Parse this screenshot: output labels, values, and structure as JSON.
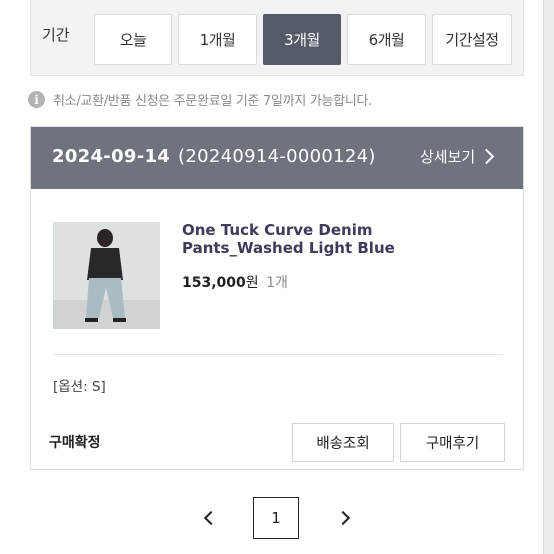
{
  "filter": {
    "label": "기간",
    "periods": [
      "오늘",
      "1개월",
      "3개월",
      "6개월",
      "기간설정"
    ],
    "active_index": 2
  },
  "notice": {
    "icon": "info-icon",
    "text": "취소/교환/반품 신청은 주문완료일 기준 7일까지 가능합니다."
  },
  "order": {
    "date": "2024-09-14",
    "order_no": "(20240914-0000124)",
    "detail_label": "상세보기",
    "product_name": "One Tuck Curve Denim Pants_Washed Light Blue",
    "price": "153,000",
    "price_unit": "원",
    "quantity": "1개",
    "option": "[옵션: S]",
    "status": "구매확정",
    "buttons": [
      "배송조회",
      "구매후기"
    ]
  },
  "pagination": {
    "current_page": "1"
  },
  "colors": {
    "header_bg": "#6e737d",
    "active_period_bg": "#555a68",
    "product_name": "#3c3c5a"
  }
}
